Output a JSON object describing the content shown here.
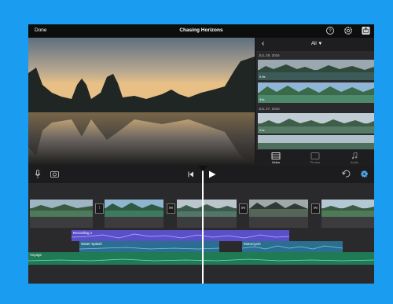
{
  "topbar": {
    "done_label": "Done",
    "title": "Chasing Horizons",
    "help_icon": "question-circle-icon",
    "settings_icon": "gear-icon",
    "share_icon": "share-icon"
  },
  "browser": {
    "back_icon": "chevron-left-icon",
    "back_glyph": "‹",
    "filter_label": "All ▼",
    "groups": [
      {
        "date": "JUL 29, 2016",
        "rows": [
          {
            "duration": "6.8s"
          },
          {
            "duration": "34s"
          }
        ]
      },
      {
        "date": "JUL 27, 2016",
        "rows": [
          {
            "duration": "21s"
          }
        ]
      }
    ],
    "tabs": [
      {
        "label": "Video",
        "icon": "film-icon",
        "active": true
      },
      {
        "label": "Photos",
        "icon": "photos-icon",
        "active": false
      },
      {
        "label": "Audio",
        "icon": "music-note-icon",
        "active": false
      }
    ]
  },
  "controls": {
    "mic_icon": "microphone-icon",
    "camera_icon": "camera-icon",
    "skip_back_icon": "skip-back-icon",
    "play_icon": "play-icon",
    "undo_icon": "undo-icon",
    "settings_icon": "gear-icon"
  },
  "timeline": {
    "audio_tracks": [
      {
        "label": "Recording 1",
        "color": "#5a4fc8"
      },
      {
        "label": "Water Splash",
        "color": "#2a6f90"
      },
      {
        "label": "Motorcycle",
        "color": "#2a6f90"
      },
      {
        "label": "Voyage",
        "color": "#1f7a55"
      }
    ]
  }
}
